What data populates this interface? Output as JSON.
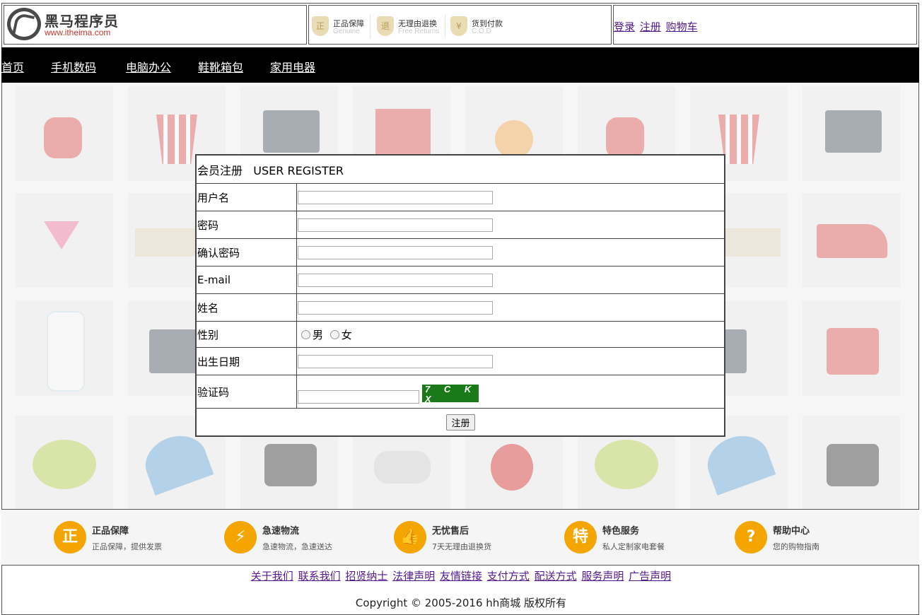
{
  "header": {
    "logo_text": "黑马程序员",
    "logo_url": "www.itheima.com",
    "promos": [
      {
        "icon": "shield-icon",
        "glyph": "正",
        "title": "正品保障",
        "sub": "Genuine"
      },
      {
        "icon": "return-icon",
        "glyph": "退",
        "title": "无理由退换",
        "sub": "Free Returns"
      },
      {
        "icon": "cod-icon",
        "glyph": "¥",
        "title": "货到付款",
        "sub": "C.O.D"
      }
    ],
    "links": {
      "login": "登录",
      "register": "注册",
      "cart": "购物车"
    }
  },
  "nav": {
    "items": [
      "首页",
      "手机数码",
      "电脑办公",
      "鞋靴箱包",
      "家用电器"
    ]
  },
  "form": {
    "title": "会员注册",
    "title_en": "USER REGISTER",
    "username_label": "用户名",
    "password_label": "密码",
    "confirm_label": "确认密码",
    "email_label": "E-mail",
    "name_label": "姓名",
    "gender_label": "性别",
    "gender_male": "男",
    "gender_female": "女",
    "birthday_label": "出生日期",
    "captcha_label": "验证码",
    "captcha_text": "7 C K X",
    "submit_label": "注册"
  },
  "services": [
    {
      "glyph": "正",
      "title": "正品保障",
      "desc": "正品保障，提供发票"
    },
    {
      "glyph": "⚡",
      "title": "急速物流",
      "desc": "急速物流，急速送达"
    },
    {
      "glyph": "👍",
      "title": "无忧售后",
      "desc": "7天无理由退换货"
    },
    {
      "glyph": "特",
      "title": "特色服务",
      "desc": "私人定制家电套餐"
    },
    {
      "glyph": "?",
      "title": "帮助中心",
      "desc": "您的购物指南"
    }
  ],
  "footer": {
    "links": [
      "关于我们",
      "联系我们",
      "招贤纳士",
      "法律声明",
      "友情链接",
      "支付方式",
      "配送方式",
      "服务声明",
      "广告声明"
    ],
    "copyright": "Copyright © 2005-2016 hh商城 版权所有"
  },
  "colors": {
    "accent": "#f5a500",
    "nav_bg": "#000000",
    "link": "#551a8b"
  }
}
